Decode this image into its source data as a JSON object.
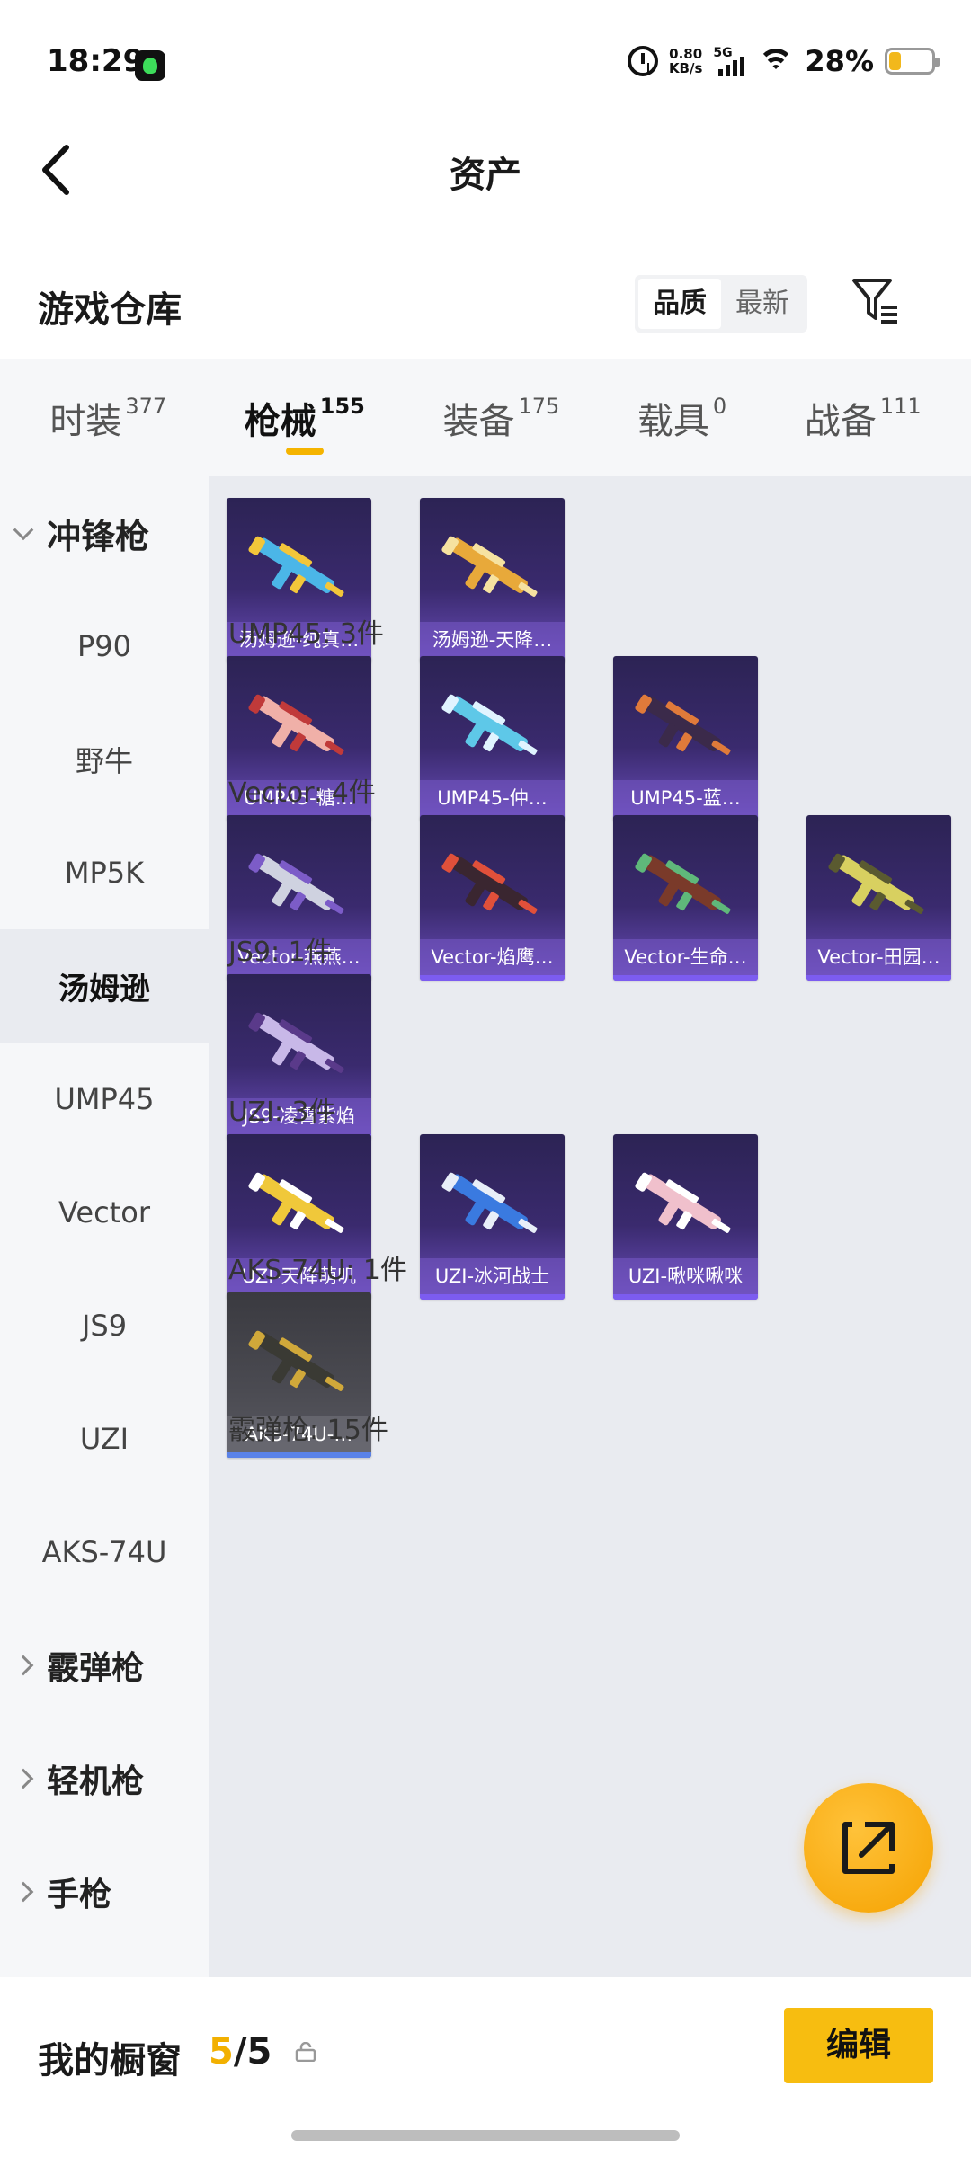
{
  "status_bar": {
    "time": "18:29",
    "net_speed_value": "0.80",
    "net_speed_unit": "KB/s",
    "network": "5G",
    "battery_pct": "28%",
    "battery_level": 0.28
  },
  "header": {
    "title": "资产"
  },
  "warehouse": {
    "title": "游戏仓库",
    "sort_options": [
      "品质",
      "最新"
    ],
    "selected_sort": "品质"
  },
  "tabs": [
    {
      "label": "时装",
      "count": "377"
    },
    {
      "label": "枪械",
      "count": "155",
      "active": true
    },
    {
      "label": "装备",
      "count": "175"
    },
    {
      "label": "载具",
      "count": "0"
    },
    {
      "label": "战备",
      "count": "111"
    }
  ],
  "sidebar": {
    "items": [
      {
        "label": "冲锋枪",
        "type": "group",
        "expanded": true
      },
      {
        "label": "P90",
        "type": "sub"
      },
      {
        "label": "野牛",
        "type": "sub"
      },
      {
        "label": "MP5K",
        "type": "sub"
      },
      {
        "label": "汤姆逊",
        "type": "sub",
        "selected": true
      },
      {
        "label": "UMP45",
        "type": "sub"
      },
      {
        "label": "Vector",
        "type": "sub"
      },
      {
        "label": "JS9",
        "type": "sub"
      },
      {
        "label": "UZI",
        "type": "sub"
      },
      {
        "label": "AKS-74U",
        "type": "sub"
      },
      {
        "label": "霰弹枪",
        "type": "group",
        "expanded": false
      },
      {
        "label": "轻机枪",
        "type": "group",
        "expanded": false
      },
      {
        "label": "手枪",
        "type": "group",
        "expanded": false
      }
    ]
  },
  "sections": [
    {
      "label": "",
      "items": [
        {
          "name": "汤姆逊-纯真…",
          "color": "#4bb6e8",
          "accent": "#f3c63a"
        },
        {
          "name": "汤姆逊-天降…",
          "color": "#e8a93a",
          "accent": "#f6e2a0"
        }
      ]
    },
    {
      "label": "UMP45: 3件",
      "items": [
        {
          "name": "UMP45-糖…",
          "color": "#f0b0a8",
          "accent": "#c03a3a"
        },
        {
          "name": "UMP45-仲…",
          "color": "#5ec8e8",
          "accent": "#e0f4ff"
        },
        {
          "name": "UMP45-蓝…",
          "color": "#3b2a4a",
          "accent": "#e07a3a"
        }
      ]
    },
    {
      "label": "Vector: 4件",
      "items": [
        {
          "name": "Vector-燕燕…",
          "color": "#cfd2e0",
          "accent": "#7c5cc8"
        },
        {
          "name": "Vector-焰鹰…",
          "color": "#3a2630",
          "accent": "#e0503a"
        },
        {
          "name": "Vector-生命…",
          "color": "#7a3a2a",
          "accent": "#5fb87a"
        },
        {
          "name": "Vector-田园…",
          "color": "#d8d060",
          "accent": "#5a5a30"
        }
      ]
    },
    {
      "label": "JS9: 1件",
      "items": [
        {
          "name": "JS9-凌霄紫焰",
          "color": "#c8b8e8",
          "accent": "#5a3a8a"
        }
      ]
    },
    {
      "label": "UZI: 3件",
      "items": [
        {
          "name": "UZI-天降萌叽",
          "color": "#f0c83a",
          "accent": "#ffffff"
        },
        {
          "name": "UZI-冰河战士",
          "color": "#3a7ae0",
          "accent": "#e8eef8"
        },
        {
          "name": "UZI-啾咪啾咪",
          "color": "#f0c0cc",
          "accent": "#ffffff"
        }
      ]
    },
    {
      "label": "AKS-74U: 1件",
      "grey": true,
      "items": [
        {
          "name": "AKS-74U-…",
          "color": "#3a3a34",
          "accent": "#d0a83a"
        }
      ]
    },
    {
      "label": "霰弹枪: 15件",
      "items": []
    }
  ],
  "bottom": {
    "label": "我的橱窗",
    "count_used": "5",
    "count_sep": "/5",
    "edit_label": "编辑"
  },
  "colors": {
    "accent": "#f5b400",
    "card_top": "#2c2354",
    "card_bottom": "#6a4dbb",
    "content_bg": "#e9ebf0"
  }
}
